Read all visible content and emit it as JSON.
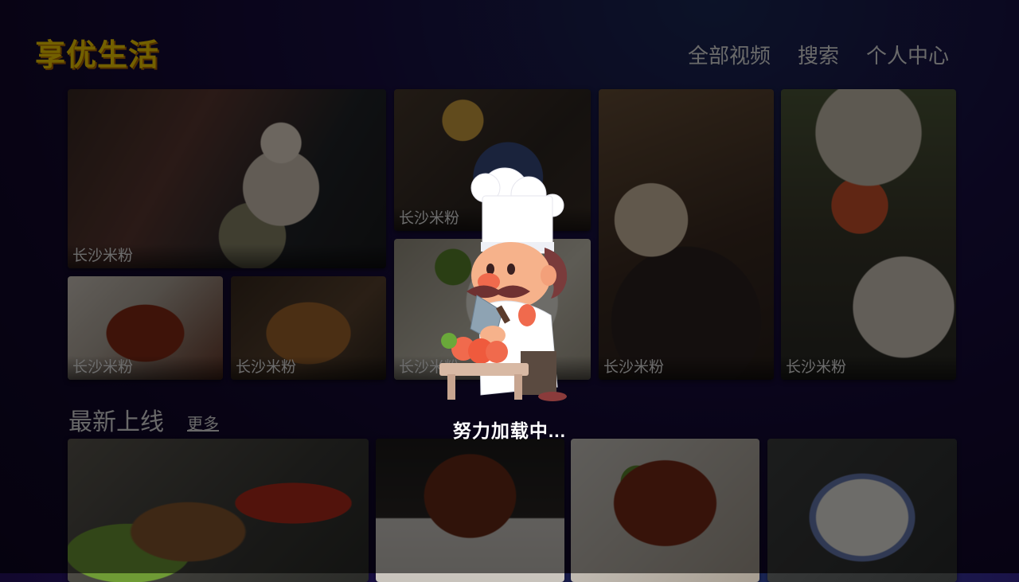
{
  "app": {
    "logo": "享优生活"
  },
  "nav": {
    "items": [
      "全部视频",
      "搜索",
      "个人中心"
    ]
  },
  "featured": {
    "tiles": [
      {
        "caption": "长沙米粉",
        "image": "chef-holding-plate"
      },
      {
        "caption": "长沙米粉",
        "image": "table-spread"
      },
      {
        "caption": "长沙米粉",
        "image": "braised-pork-slices"
      },
      {
        "caption": "长沙米粉",
        "image": "stir-fried-noodles"
      },
      {
        "caption": "长沙米粉",
        "image": "rice-bowl"
      },
      {
        "caption": "长沙米粉",
        "image": "claypot-soup"
      },
      {
        "caption": "长沙米粉",
        "image": "shrimp-hotpot"
      }
    ]
  },
  "latest": {
    "title": "最新上线",
    "more": "更多",
    "tiles": [
      {
        "image": "bread-and-peppers"
      },
      {
        "image": "braised-ribs"
      },
      {
        "image": "stir-fried-beef"
      },
      {
        "image": "rice-noodle-plate"
      }
    ]
  },
  "loading": {
    "text": "努力加载中...",
    "icon": "chef-mascot-icon"
  }
}
